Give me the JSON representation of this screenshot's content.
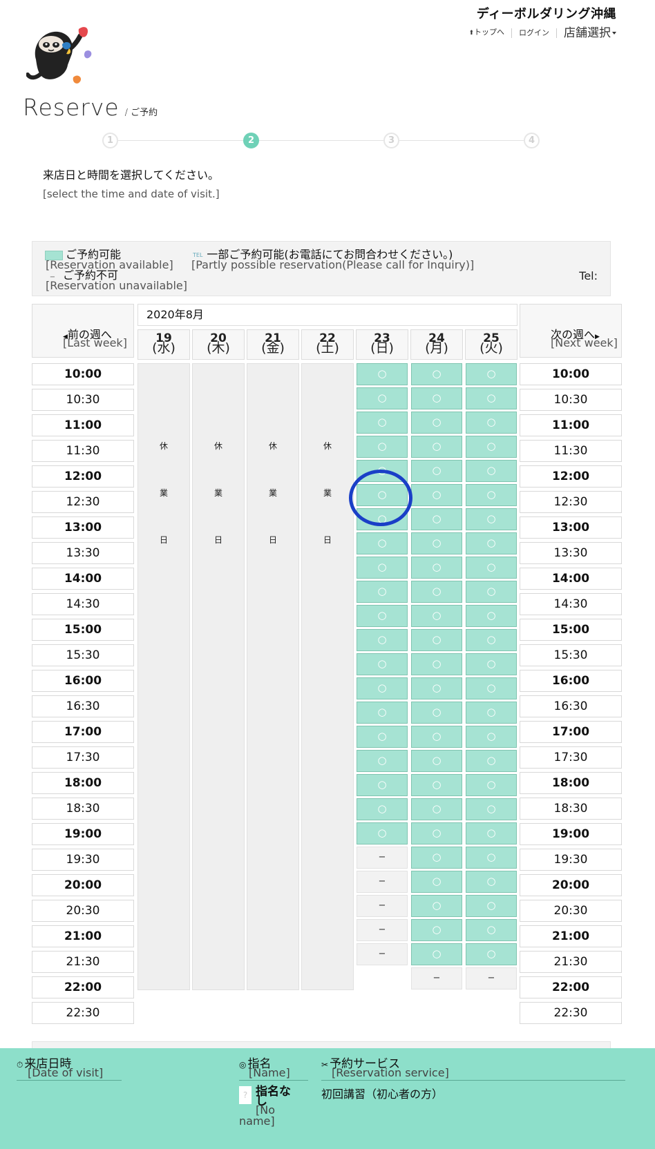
{
  "header": {
    "shop_name": "ディーボルダリング沖縄",
    "home_link": "トップへ",
    "login_link": "ログイン",
    "shop_select": "店舗選択"
  },
  "page": {
    "title": "Reserve",
    "subtitle": "/  ご予約"
  },
  "steps": [
    "1",
    "2",
    "3",
    "4"
  ],
  "active_step": 2,
  "instructions": {
    "jp": "来店日と時間を選択してください。",
    "en": "[select the time and date of visit.]"
  },
  "legend": {
    "available_jp": "ご予約可能",
    "available_en": "[Reservation available]",
    "partial_icon": "TEL",
    "partial_jp": "一部ご予約可能(お電話にてお問合わせください。)",
    "partial_en": "[Partly possible reservation(Please call for Inquiry)]",
    "unavailable_symbol": "−",
    "unavailable_jp": "ご予約不可",
    "unavailable_en": "[Reservation unavailable]",
    "tel_label": "Tel:"
  },
  "calendar": {
    "month": "2020年8月",
    "prev_week_jp": "前の週へ",
    "prev_week_en": "[Last week]",
    "next_week_jp": "次の週へ",
    "next_week_en": "[Next week]",
    "days": [
      {
        "date": "19",
        "dow": "(水)"
      },
      {
        "date": "20",
        "dow": "(木)"
      },
      {
        "date": "21",
        "dow": "(金)"
      },
      {
        "date": "22",
        "dow": "(土)"
      },
      {
        "date": "23",
        "dow": "(日)"
      },
      {
        "date": "24",
        "dow": "(月)"
      },
      {
        "date": "25",
        "dow": "(火)"
      }
    ],
    "times": [
      "10:00",
      "10:30",
      "11:00",
      "11:30",
      "12:00",
      "12:30",
      "13:00",
      "13:30",
      "14:00",
      "14:30",
      "15:00",
      "15:30",
      "16:00",
      "16:30",
      "17:00",
      "17:30",
      "18:00",
      "18:30",
      "19:00",
      "19:30",
      "20:00",
      "20:30",
      "21:00",
      "21:30",
      "22:00",
      "22:30"
    ],
    "closed_label": [
      "休",
      "業",
      "日"
    ],
    "available_symbol": "○",
    "unavailable_symbol": "−",
    "open_columns": [
      {
        "day": "23",
        "available": 20,
        "unavailable": 5
      },
      {
        "day": "24",
        "available": 25,
        "unavailable": 1
      },
      {
        "day": "25",
        "available": 25,
        "unavailable": 1
      }
    ]
  },
  "footer": {
    "date_jp": "来店日時",
    "date_en": "[Date of visit]",
    "name_jp": "指名",
    "name_en": "[Name]",
    "noname_box": "?",
    "noname_jp": "指名なし",
    "noname_en": "[No name]",
    "service_jp": "予約サービス",
    "service_en": "[Reservation service]",
    "service_value": "初回講習（初心者の方）"
  },
  "colors": {
    "accent": "#6fd1b7",
    "available_cell": "#a6e3d3",
    "footer_bg": "#8ddfca",
    "highlight": "#1a3fc7"
  }
}
